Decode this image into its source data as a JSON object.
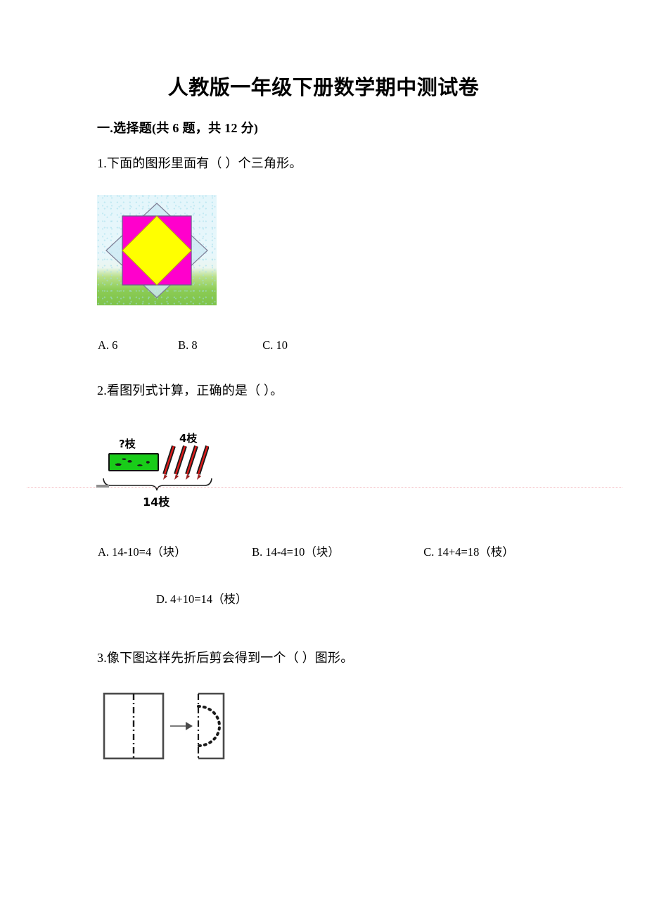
{
  "document": {
    "title": "人教版一年级下册数学期中测试卷",
    "section_heading": "一.选择题(共 6 题，共 12 分)"
  },
  "questions": [
    {
      "id": "q1",
      "text": "1.下面的图形里面有（        ）个三角形。",
      "figure": {
        "name": "nested-shapes-figure",
        "description": "浅蓝色菱形内含洋红色正方形，内含黄色菱形，背景为天空与草地",
        "colors": {
          "sky": "#e4f6fb",
          "grass": "#8ccc55",
          "diamond_outer": "#cbe8f2",
          "square": "#ff00cc",
          "diamond_inner": "#ffff00",
          "outline": "#6b6b8a"
        }
      },
      "options": [
        {
          "key": "A",
          "label": "A. 6"
        },
        {
          "key": "B",
          "label": "B. 8"
        },
        {
          "key": "C",
          "label": "C. 10"
        }
      ]
    },
    {
      "id": "q2",
      "text": "2.看图列式计算，正确的是（        ）。",
      "figure": {
        "name": "pencil-case-and-pencils-figure",
        "label_case": "?枝",
        "label_pencils": "4枝",
        "label_total": "14枝",
        "pencil_count": 4,
        "colors": {
          "case": "#19cc19",
          "case_border": "#111111",
          "pencil_body": "#e01b1b",
          "pencil_stripe": "#1a1a1a"
        }
      },
      "options": [
        {
          "key": "A",
          "label": "A. 14-10=4（块）"
        },
        {
          "key": "B",
          "label": "B. 14-4=10（块）"
        },
        {
          "key": "C",
          "label": "C. 14+4=18（枝）"
        },
        {
          "key": "D",
          "label": "D. 4+10=14（枝）"
        }
      ]
    },
    {
      "id": "q3",
      "text": "3.像下图这样先折后剪会得到一个（      ）图形。",
      "figure": {
        "name": "fold-and-cut-figure",
        "description": "左为带中心折痕线的正方形，箭头指向右边带虚线半圆剪切线的正方形"
      },
      "options": []
    }
  ],
  "page_marks": {
    "binding_line_color": "#f3b6bc"
  }
}
